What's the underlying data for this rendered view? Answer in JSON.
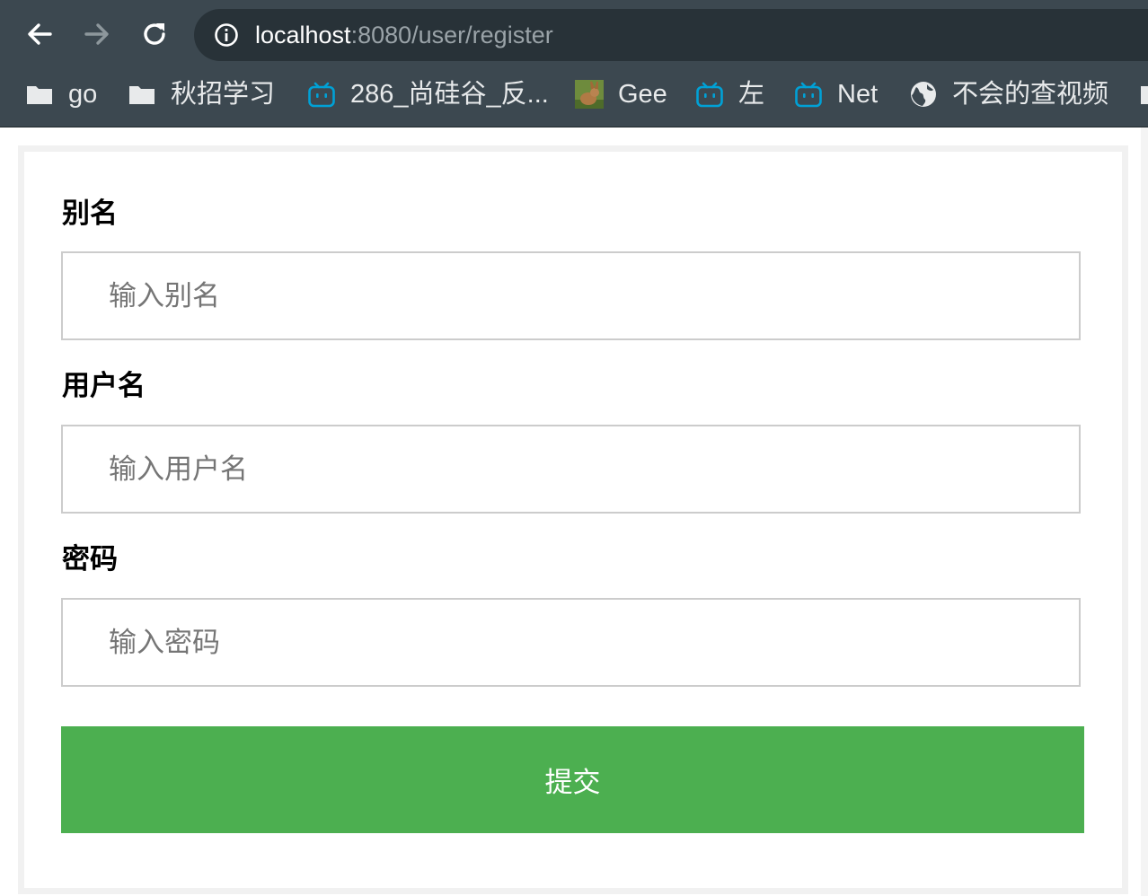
{
  "browser": {
    "url_host": "localhost",
    "url_path": ":8080/user/register",
    "bookmarks": [
      {
        "label": "go",
        "icon": "folder-icon"
      },
      {
        "label": "秋招学习",
        "icon": "folder-icon"
      },
      {
        "label": "286_尚硅谷_反...",
        "icon": "bilibili-icon"
      },
      {
        "label": "Gee",
        "icon": "rabbit-favicon"
      },
      {
        "label": "左",
        "icon": "bilibili-icon"
      },
      {
        "label": "Net",
        "icon": "bilibili-icon"
      },
      {
        "label": "不会的查视频",
        "icon": "globe-icon"
      }
    ]
  },
  "form": {
    "alias_label": "别名",
    "alias_placeholder": "输入别名",
    "username_label": "用户名",
    "username_placeholder": "输入用户名",
    "password_label": "密码",
    "password_placeholder": "输入密码",
    "submit_label": "提交"
  },
  "colors": {
    "toolbar_bg": "#3c4850",
    "omnibox_bg": "#283238",
    "submit_bg": "#4caf50",
    "bilibili_blue": "#00a1d6"
  }
}
